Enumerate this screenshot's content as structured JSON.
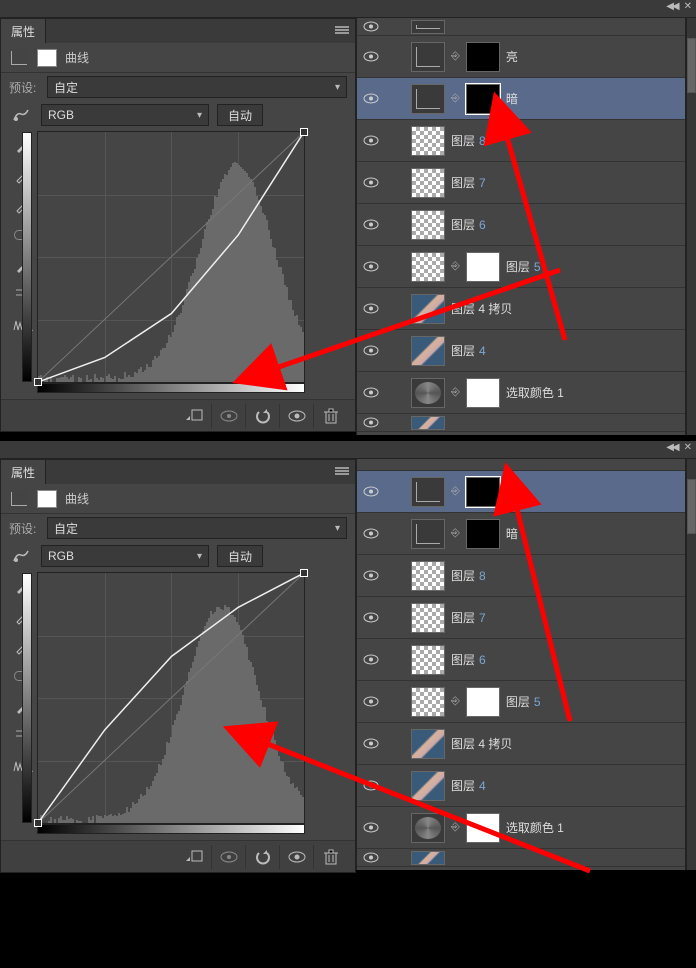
{
  "panels": [
    {
      "title_tab": "属性",
      "adjustment_name": "曲线",
      "preset_label": "预设:",
      "preset_value": "自定",
      "channel_value": "RGB",
      "auto_btn": "自动",
      "selected_index": 2,
      "chart_data": {
        "type": "line",
        "title": "曲线",
        "xlabel": "",
        "ylabel": "",
        "x": [
          0,
          64,
          128,
          192,
          255
        ],
        "curve": [
          0,
          25,
          70,
          150,
          255
        ],
        "diag": [
          0,
          64,
          128,
          192,
          255
        ],
        "xlim": [
          0,
          255
        ],
        "ylim": [
          0,
          255
        ],
        "histogram_peak_x": 190
      }
    },
    {
      "title_tab": "属性",
      "adjustment_name": "曲线",
      "preset_label": "预设:",
      "preset_value": "自定",
      "channel_value": "RGB",
      "auto_btn": "自动",
      "selected_index": 1,
      "chart_data": {
        "type": "line",
        "title": "曲线",
        "xlabel": "",
        "ylabel": "",
        "x": [
          0,
          64,
          128,
          192,
          255
        ],
        "curve": [
          0,
          95,
          170,
          220,
          255
        ],
        "diag": [
          0,
          64,
          128,
          192,
          255
        ],
        "xlim": [
          0,
          255
        ],
        "ylim": [
          0,
          255
        ],
        "histogram_peak_x": 175
      }
    }
  ],
  "layers": [
    {
      "kind": "half-top"
    },
    {
      "kind": "curves",
      "name": "亮",
      "mask": "dark"
    },
    {
      "kind": "curves",
      "name": "暗",
      "mask": "dark"
    },
    {
      "kind": "pixel-tr",
      "name": "图层",
      "num": "8"
    },
    {
      "kind": "pixel-tr",
      "name": "图层",
      "num": "7"
    },
    {
      "kind": "pixel-tr",
      "name": "图层",
      "num": "6"
    },
    {
      "kind": "pixel-tr-mask",
      "name": "图层",
      "num": "5"
    },
    {
      "kind": "img",
      "name": "图层 4 拷贝"
    },
    {
      "kind": "img",
      "name": "图层",
      "num": "4"
    },
    {
      "kind": "selcolor",
      "name": "选取颜色 1"
    },
    {
      "kind": "half-img"
    }
  ],
  "layers2": [
    {
      "kind": "half-top2"
    },
    {
      "kind": "curves",
      "name": "亮",
      "mask": "dark"
    },
    {
      "kind": "curves",
      "name": "暗",
      "mask": "dark"
    },
    {
      "kind": "pixel-tr",
      "name": "图层",
      "num": "8"
    },
    {
      "kind": "pixel-tr",
      "name": "图层",
      "num": "7"
    },
    {
      "kind": "pixel-tr",
      "name": "图层",
      "num": "6"
    },
    {
      "kind": "pixel-tr-mask",
      "name": "图层",
      "num": "5"
    },
    {
      "kind": "img",
      "name": "图层 4 拷贝"
    },
    {
      "kind": "img",
      "name": "图层",
      "num": "4"
    },
    {
      "kind": "selcolor",
      "name": "选取颜色 1"
    },
    {
      "kind": "half-img"
    }
  ],
  "icons": {
    "eye": "◉",
    "link": "⎘",
    "reset": "↶",
    "visible": "◉",
    "trash": "🗑",
    "clip": "⬚",
    "eyedrop": "✎"
  }
}
